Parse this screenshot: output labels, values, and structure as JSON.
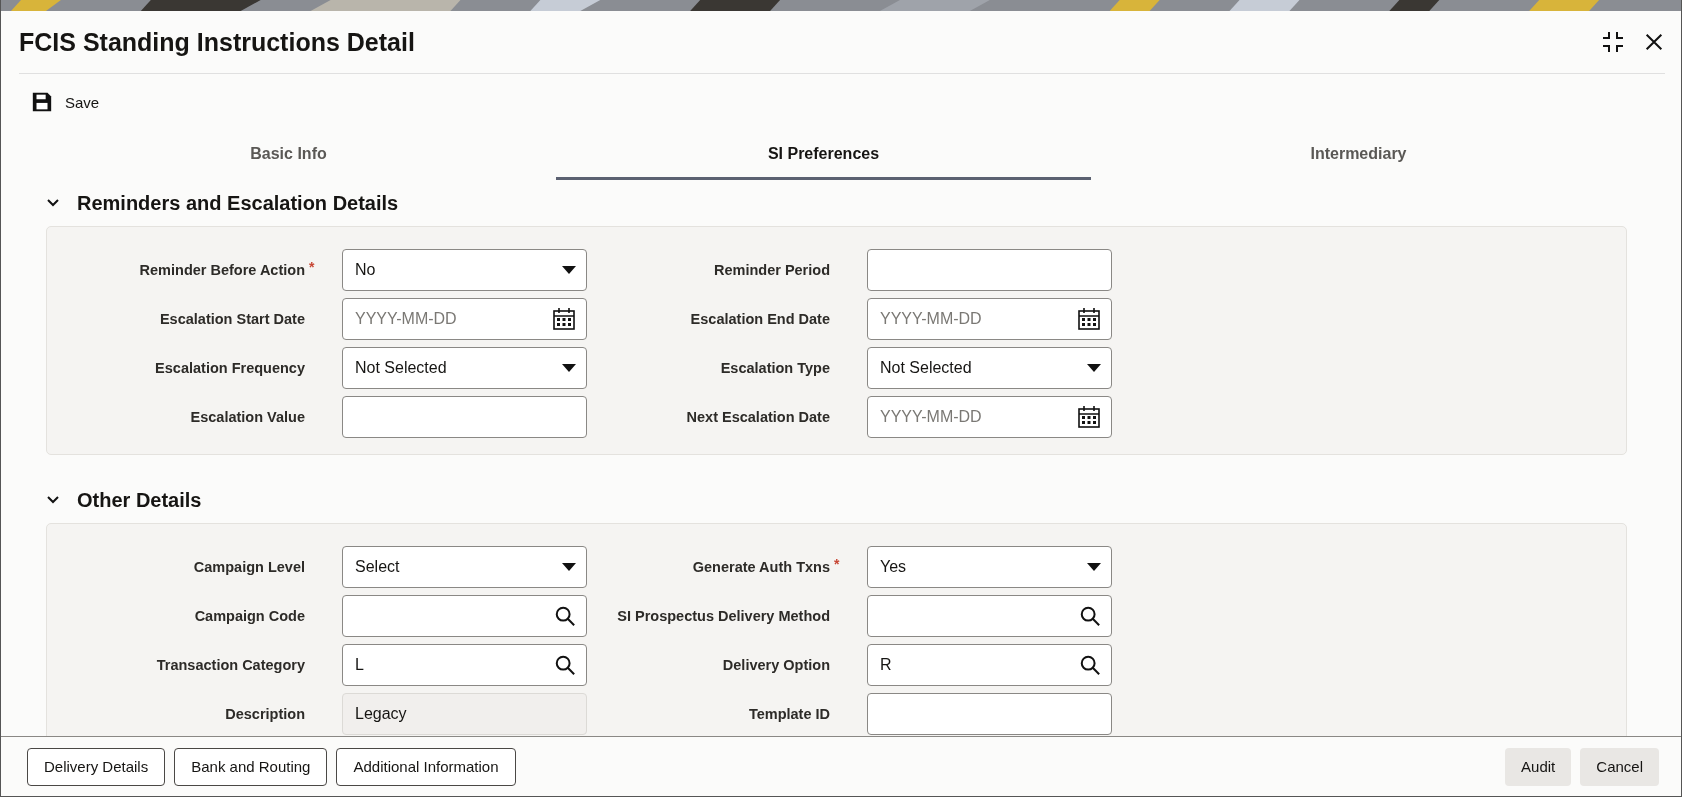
{
  "window": {
    "title": "FCIS Standing Instructions Detail"
  },
  "toolbar": {
    "save": "Save"
  },
  "tabs": [
    {
      "label": "Basic Info",
      "selected": false
    },
    {
      "label": "SI Preferences",
      "selected": true
    },
    {
      "label": "Intermediary",
      "selected": false
    }
  ],
  "sections": [
    {
      "title": "Reminders and Escalation Details",
      "expanded": true,
      "fields": [
        {
          "label": "Reminder Before Action",
          "kind": "select",
          "value": "No",
          "required_mark": "*"
        },
        {
          "label": "Reminder Period",
          "kind": "text"
        },
        {
          "label": "Escalation Start Date",
          "kind": "date",
          "placeholder": "YYYY-MM-DD"
        },
        {
          "label": "Escalation End Date",
          "kind": "date",
          "placeholder": "YYYY-MM-DD"
        },
        {
          "label": "Escalation Frequency",
          "kind": "select",
          "value": "Not Selected"
        },
        {
          "label": "Escalation Type",
          "kind": "select",
          "value": "Not Selected"
        },
        {
          "label": "Escalation Value",
          "kind": "text"
        },
        {
          "label": "Next Escalation Date",
          "kind": "date",
          "placeholder": "YYYY-MM-DD"
        }
      ]
    },
    {
      "title": "Other Details",
      "expanded": true,
      "fields": [
        {
          "label": "Campaign Level",
          "kind": "select",
          "value": "Select"
        },
        {
          "label": "Generate Auth Txns",
          "kind": "select",
          "value": "Yes",
          "required_mark": "*"
        },
        {
          "label": "Campaign Code",
          "kind": "lookup"
        },
        {
          "label": "SI Prospectus Delivery Method",
          "kind": "lookup"
        },
        {
          "label": "Transaction Category",
          "kind": "lookup",
          "value": "L"
        },
        {
          "label": "Delivery Option",
          "kind": "lookup",
          "value": "R"
        },
        {
          "label": "Description",
          "kind": "readonly",
          "value": "Legacy"
        },
        {
          "label": "Template ID",
          "kind": "text"
        }
      ]
    }
  ],
  "footer": {
    "left_buttons": [
      "Delivery Details",
      "Bank and Routing",
      "Additional Information"
    ],
    "right_buttons": [
      "Audit",
      "Cancel"
    ]
  }
}
